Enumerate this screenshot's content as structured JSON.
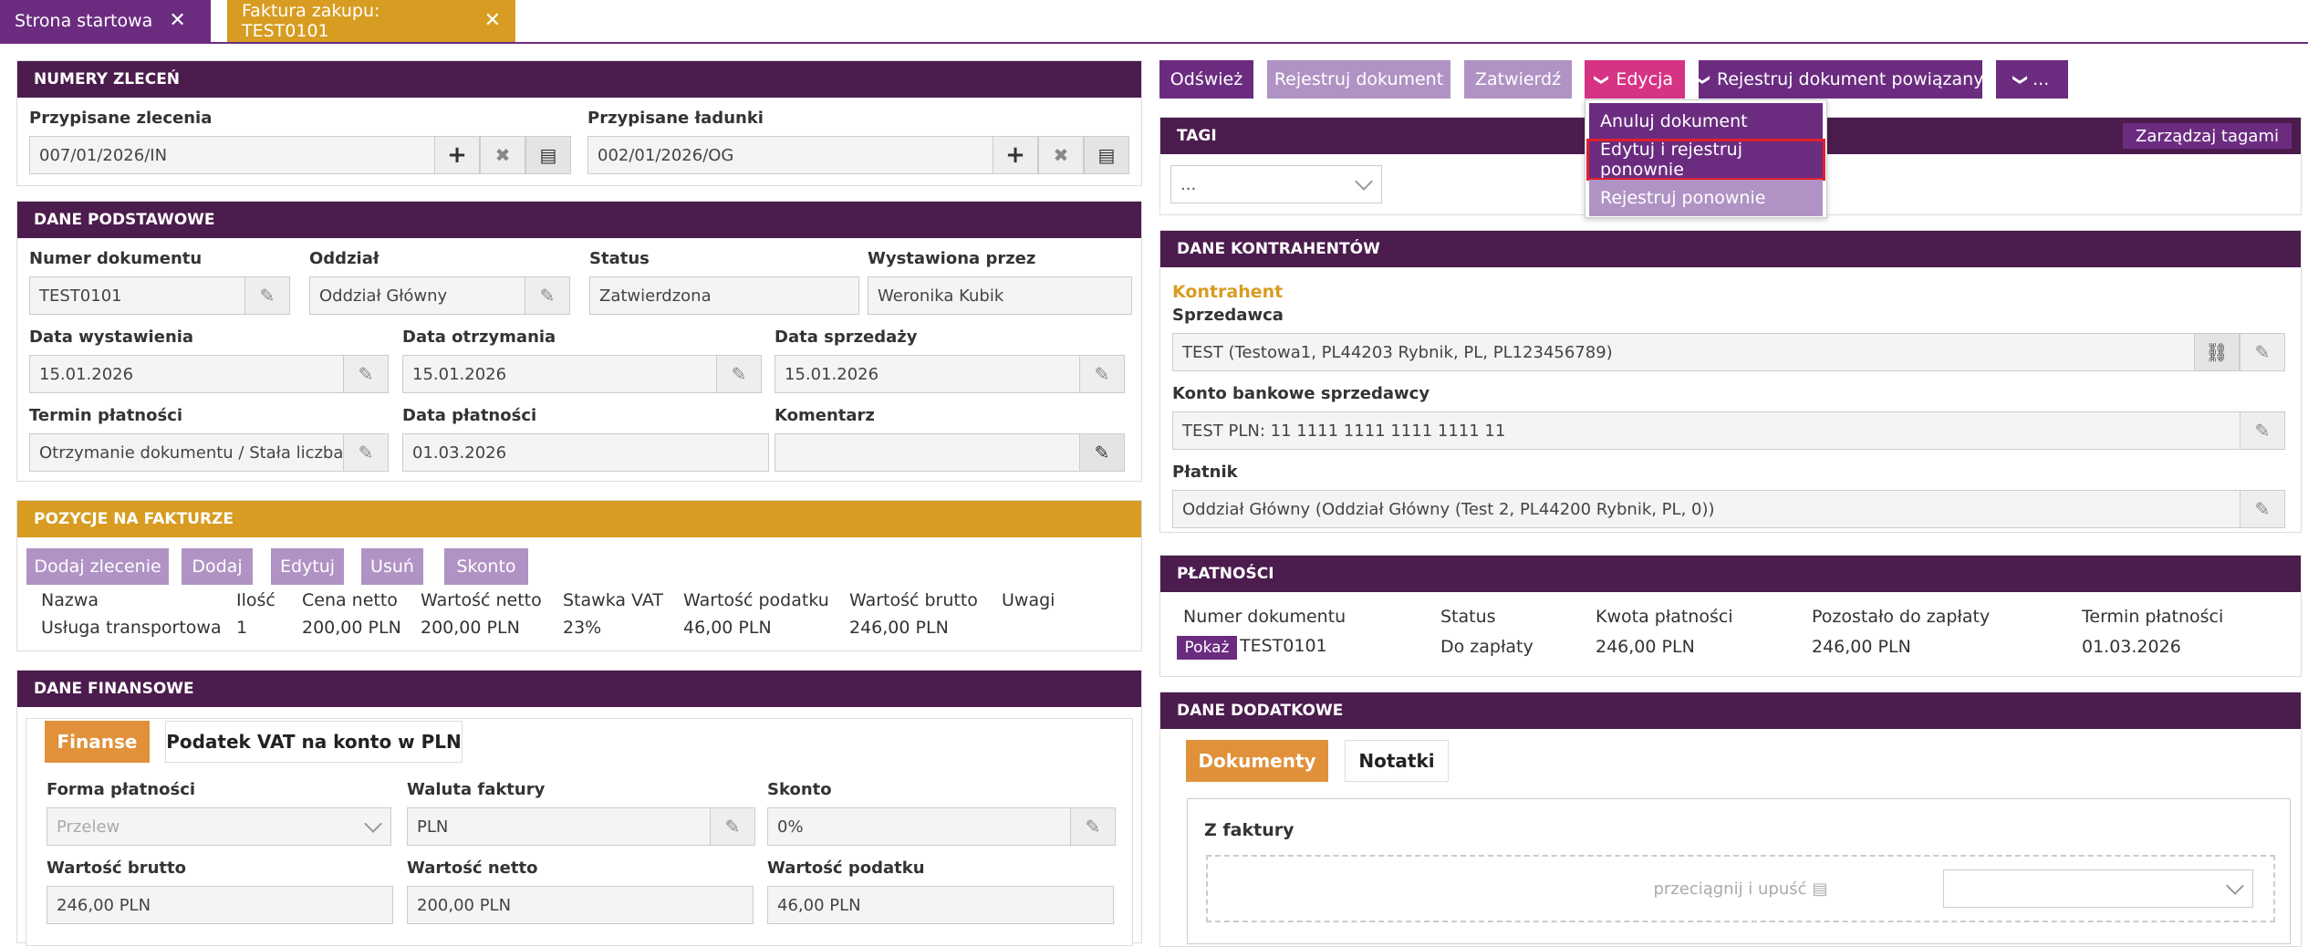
{
  "tabs": [
    {
      "label": "Strona startowa"
    },
    {
      "label": "Faktura zakupu: TEST0101"
    }
  ],
  "toolbar": {
    "refresh": "Odśwież",
    "register_doc": "Rejestruj dokument",
    "approve": "Zatwierdź",
    "edit": "Edycja",
    "register_related": "Rejestruj dokument powiązany",
    "more": "..."
  },
  "edit_menu": {
    "items": [
      "Anuluj dokument",
      "Edytuj i rejestruj ponownie",
      "Rejestruj ponownie"
    ]
  },
  "orders": {
    "title": "NUMERY ZLECEŃ",
    "assigned_orders_label": "Przypisane zlecenia",
    "assigned_orders_value": "007/01/2026/IN",
    "assigned_loads_label": "Przypisane ładunki",
    "assigned_loads_value": "002/01/2026/OG"
  },
  "basic": {
    "title": "DANE PODSTAWOWE",
    "doc_no_label": "Numer dokumentu",
    "doc_no": "TEST0101",
    "branch_label": "Oddział",
    "branch": "Oddział Główny",
    "status_label": "Status",
    "status": "Zatwierdzona",
    "issued_by_label": "Wystawiona przez",
    "issued_by": "Weronika Kubik",
    "issue_date_label": "Data wystawienia",
    "issue_date": "15.01.2026",
    "receipt_date_label": "Data otrzymania",
    "receipt_date": "15.01.2026",
    "sale_date_label": "Data sprzedaży",
    "sale_date": "15.01.2026",
    "payment_term_label": "Termin płatności",
    "payment_term": "Otrzymanie dokumentu / Stała liczba",
    "payment_date_label": "Data płatności",
    "payment_date": "01.03.2026",
    "comment_label": "Komentarz",
    "comment": ""
  },
  "positions": {
    "title": "POZYCJE NA FAKTURZE",
    "buttons": [
      "Dodaj zlecenie",
      "Dodaj",
      "Edytuj",
      "Usuń",
      "Skonto"
    ],
    "headers": [
      "Nazwa",
      "Ilość",
      "Cena netto",
      "Wartość netto",
      "Stawka VAT",
      "Wartość podatku",
      "Wartość brutto",
      "Uwagi"
    ],
    "rows": [
      [
        "Usługa transportowa",
        "1",
        "200,00 PLN",
        "200,00 PLN",
        "23%",
        "46,00 PLN",
        "246,00 PLN",
        ""
      ]
    ]
  },
  "finance": {
    "title": "DANE FINANSOWE",
    "tab_active": "Finanse",
    "tab_other": "Podatek VAT na konto w PLN",
    "payment_form_label": "Forma płatności",
    "payment_form": "Przelew",
    "currency_label": "Waluta faktury",
    "currency": "PLN",
    "discount_label": "Skonto",
    "discount": "0%",
    "gross_label": "Wartość brutto",
    "gross": "246,00 PLN",
    "net_label": "Wartość netto",
    "net": "200,00 PLN",
    "tax_label": "Wartość podatku",
    "tax": "46,00 PLN"
  },
  "tags": {
    "title": "TAGI",
    "manage": "Zarządzaj tagami",
    "select": "..."
  },
  "contractors": {
    "title": "DANE KONTRAHENTÓW",
    "section": "Kontrahent",
    "seller_label": "Sprzedawca",
    "seller": "TEST (Testowa1, PL44203 Rybnik, PL, PL123456789)",
    "bank_label": "Konto bankowe sprzedawcy",
    "bank": "TEST PLN: 11 1111 1111 1111 1111 11",
    "payer_label": "Płatnik",
    "payer": "Oddział Główny  (Oddział Główny  (Test 2, PL44200 Rybnik, PL, 0))"
  },
  "payments": {
    "title": "PŁATNOŚCI",
    "headers": [
      "Numer dokumentu",
      "Status",
      "Kwota płatności",
      "Pozostało do zapłaty",
      "Termin płatności"
    ],
    "show": "Pokaż",
    "doc_no": "TEST0101",
    "status": "Do zapłaty",
    "amount": "246,00 PLN",
    "remaining": "246,00 PLN",
    "due": "01.03.2026"
  },
  "extra": {
    "title": "DANE DODATKOWE",
    "tab_active": "Dokumenty",
    "tab_other": "Notatki",
    "from_invoice": "Z faktury",
    "drop": "przeciągnij i upuść"
  },
  "colors": {
    "purple": "#6b2c80",
    "dark_purple": "#4b1c4d",
    "gold": "#d79c21",
    "light_purple": "#b093c4",
    "magenta": "#d63384",
    "orange": "#e0913a"
  }
}
